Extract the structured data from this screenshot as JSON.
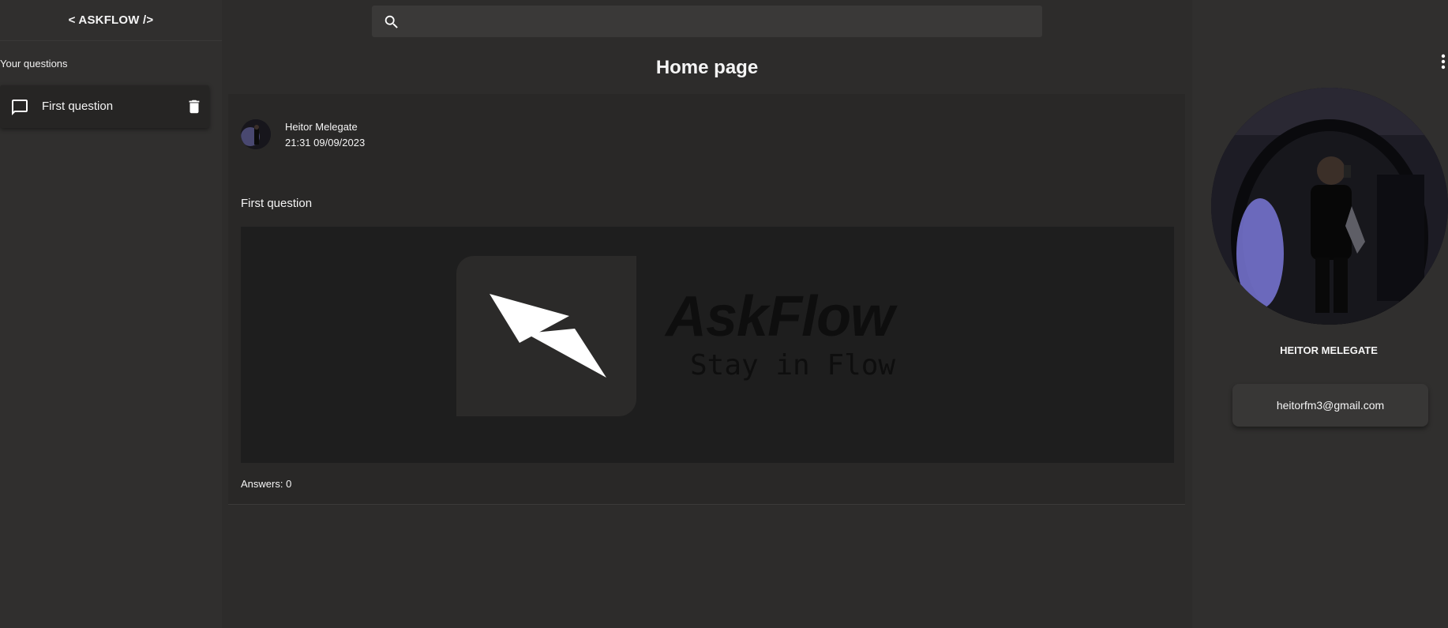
{
  "app": {
    "brand": "< ASKFLOW />"
  },
  "sidebar": {
    "section_title": "Your questions",
    "items": [
      {
        "label": "First question"
      }
    ]
  },
  "search": {
    "placeholder": ""
  },
  "main": {
    "title": "Home page",
    "post": {
      "author": "Heitor Melegate",
      "timestamp": "21:31 09/09/2023",
      "text": "First question",
      "image": {
        "brand_word": "AskFlow",
        "tagline": "Stay in Flow"
      },
      "answers_label": "Answers: 0"
    }
  },
  "profile": {
    "name": "HEITOR MELEGATE",
    "email": "heitorfm3@gmail.com"
  },
  "icons": {
    "search": "search-icon",
    "chat": "chat-icon",
    "trash": "trash-icon",
    "more": "more-vert-icon"
  }
}
